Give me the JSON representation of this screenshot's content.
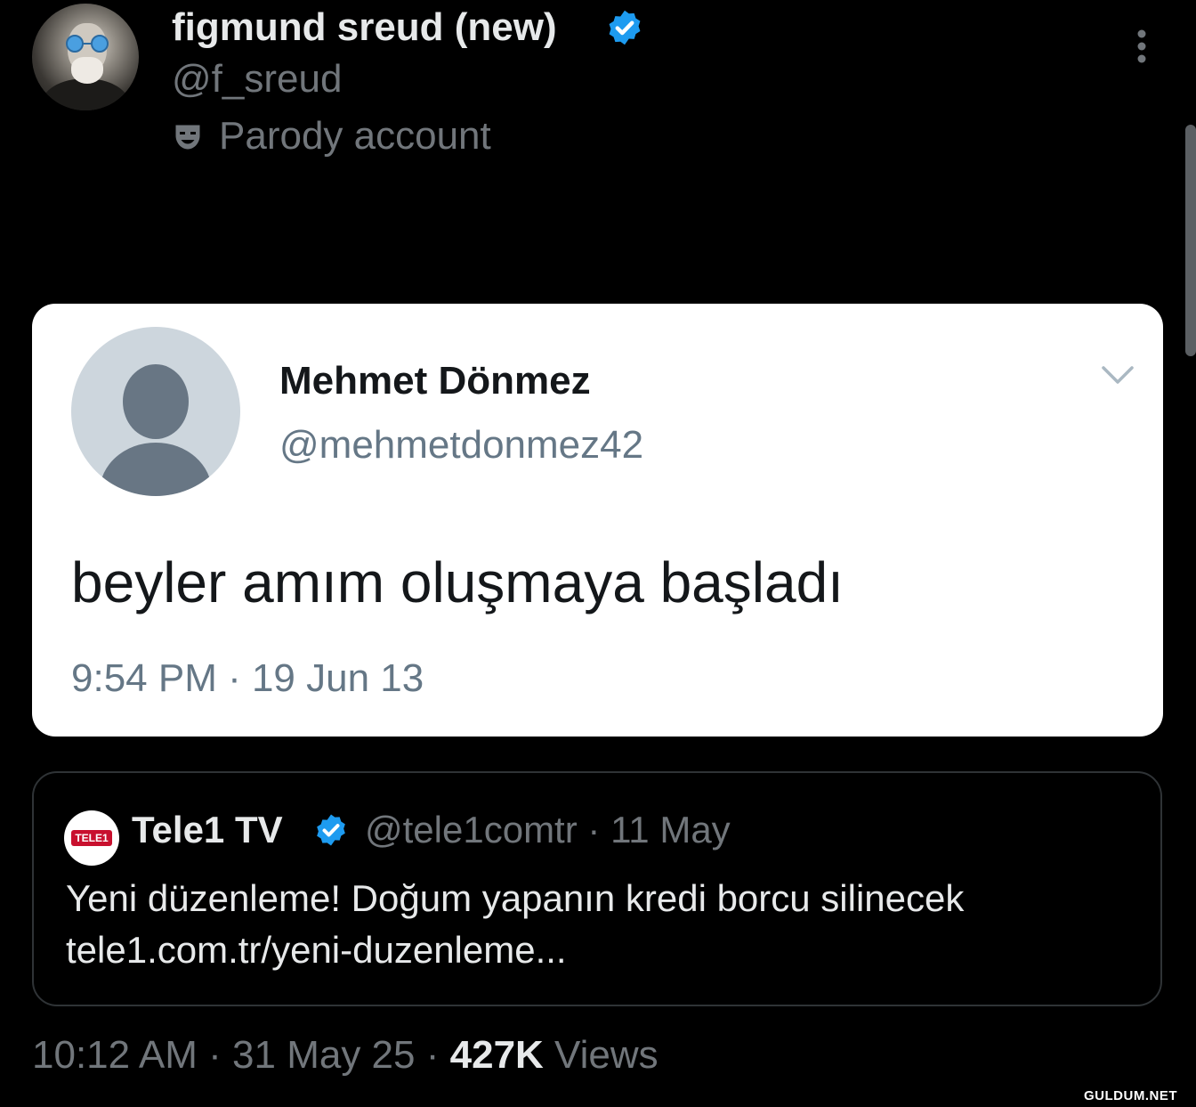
{
  "author": {
    "display_name": "figmund sreud (new)",
    "handle": "@f_sreud",
    "label": "Parody account"
  },
  "embedded_image": {
    "name": "Mehmet Dönmez",
    "handle": "@mehmetdonmez42",
    "text": "beyler amım oluşmaya başladı",
    "timestamp": "9:54 PM · 19 Jun 13"
  },
  "quoted_tweet": {
    "logo_text": "TELE1",
    "name": "Tele1 TV",
    "handle": "@tele1comtr",
    "separator": "·",
    "date": "11 May",
    "text_line1": "Yeni düzenleme! Doğum yapanın kredi borcu silinecek",
    "text_line2": "tele1.com.tr/yeni-duzenleme..."
  },
  "meta": {
    "time": "10:12 AM",
    "date": "31 May 25",
    "separator": "·",
    "views_count": "427K",
    "views_label": "Views"
  },
  "watermark": "GULDUM.NET",
  "colors": {
    "background": "#000000",
    "verified": "#1d9bf0",
    "muted_text": "#71767b",
    "primary_text": "#e7e9ea"
  },
  "icons": [
    "verified-badge-icon",
    "parody-mask-icon",
    "more-vertical-icon",
    "chevron-down-icon",
    "default-avatar-icon"
  ]
}
